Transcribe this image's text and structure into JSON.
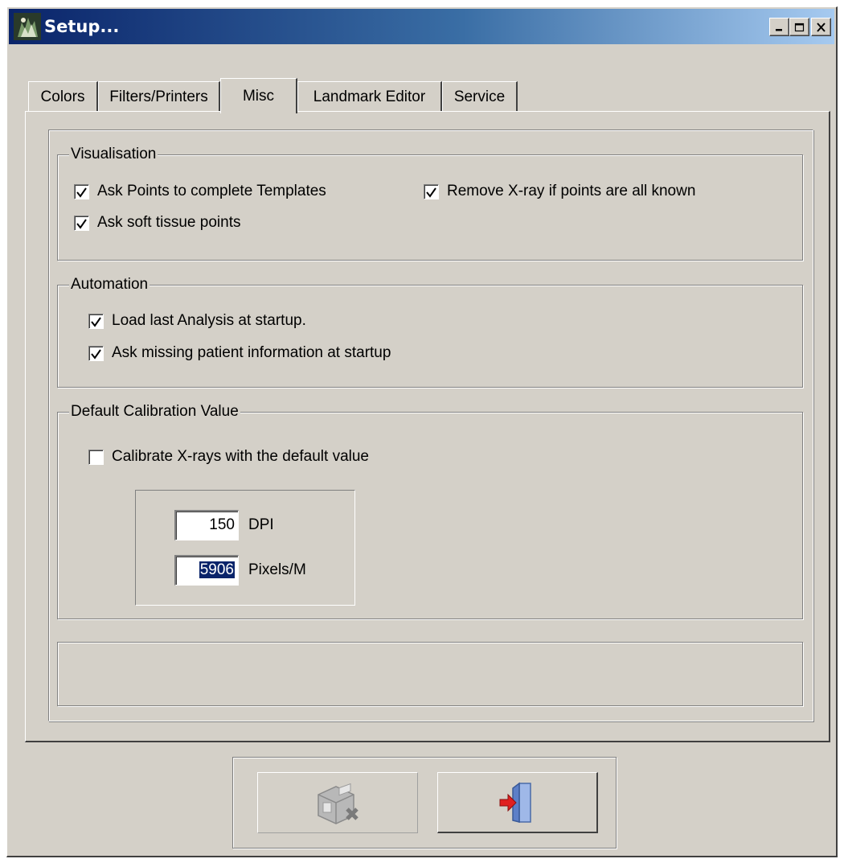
{
  "window": {
    "title": "Setup...",
    "controls": [
      "minimize-icon",
      "maximize-icon",
      "close-icon"
    ]
  },
  "tabs": [
    {
      "label": "Colors",
      "active": false
    },
    {
      "label": "Filters/Printers",
      "active": false
    },
    {
      "label": "Misc",
      "active": true
    },
    {
      "label": "Landmark Editor",
      "active": false
    },
    {
      "label": "Service",
      "active": false
    }
  ],
  "visualisation": {
    "legend": "Visualisation",
    "ask_points_label": "Ask Points to complete Templates",
    "ask_points_checked": true,
    "ask_soft_tissue_label": "Ask soft tissue points",
    "ask_soft_tissue_checked": true,
    "remove_xray_label": "Remove X-ray if points are all known",
    "remove_xray_checked": true
  },
  "automation": {
    "legend": "Automation",
    "load_last_label": "Load last Analysis at startup.",
    "load_last_checked": true,
    "ask_missing_label": "Ask missing patient information at startup",
    "ask_missing_checked": true
  },
  "calibration": {
    "legend": "Default Calibration Value",
    "calibrate_label": "Calibrate X-rays with the default value",
    "calibrate_checked": false,
    "dpi_value": "150",
    "dpi_unit": "DPI",
    "ppm_value": "5906",
    "ppm_unit": "Pixels/M"
  },
  "buttons": {
    "save_icon": "save-disk-icon",
    "save_enabled": false,
    "exit_icon": "exit-door-icon",
    "exit_enabled": true
  },
  "colors": {
    "face": "#d4d0c8",
    "title_start": "#0a246a",
    "title_end": "#a6caf0",
    "selection": "#0a246a"
  }
}
